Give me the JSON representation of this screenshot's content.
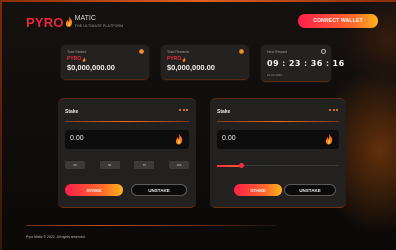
{
  "header": {
    "logo_pyro": "PYRO",
    "logo_matic": "MATIC",
    "logo_tag": "THE ULTIMATE PLATFORM",
    "connect_label": "CONNECT WALLET"
  },
  "stats": [
    {
      "label": "Total Staked",
      "mini": "PYRO",
      "value": "$0,000,000.00"
    },
    {
      "label": "Total Rewards",
      "mini": "PYRO",
      "value": "$0,000,000.00"
    }
  ],
  "countdown": {
    "label": "Next Reward",
    "hours": "09",
    "minutes": "23",
    "seconds": "36",
    "frames": "16",
    "date": "22.02.2022"
  },
  "panels": [
    {
      "title": "Stake",
      "amount": "0.00",
      "percent_options": [
        "25",
        "50",
        "75",
        "100"
      ],
      "stake_label": "STAKE",
      "unstake_label": "UNSTAKE"
    },
    {
      "title": "Stake",
      "amount": "0.00",
      "slider_value": 0.2,
      "stake_label": "STAKE",
      "unstake_label": "UNSTAKE"
    }
  ],
  "footer": {
    "text": "Pyro Matic © 2022. All rights reserved."
  },
  "colors": {
    "accent_red": "#ff1f4b",
    "accent_orange": "#ff6a2a",
    "accent_yellow": "#ffb51c",
    "card_bg": "#242221",
    "page_bg": "#0d0b0a"
  }
}
